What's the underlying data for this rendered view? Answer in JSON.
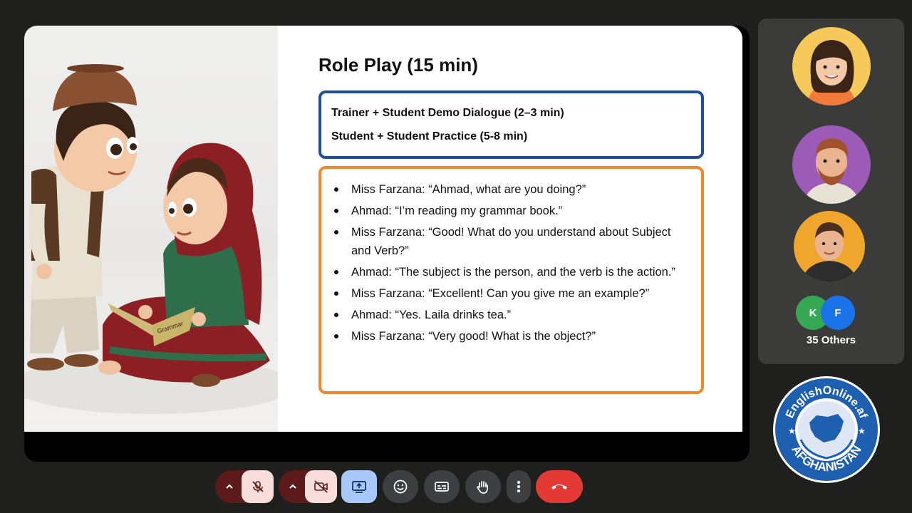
{
  "slide": {
    "title": "Role Play (15 min)",
    "modes": [
      "Trainer + Student Demo Dialogue (2–3 min)",
      "Student + Student Practice (5-8 min)"
    ],
    "dialogue": [
      "Miss Farzana: “Ahmad, what are you doing?”",
      "Ahmad: “I’m reading my grammar book.”",
      "Miss Farzana: “Good! What do you understand about Subject and Verb?”",
      "Ahmad: “The subject is the person, and the verb is the action.”",
      "Miss Farzana: “Excellent! Can you give me an example?”",
      "Ahmad: “Yes. Laila drinks tea.”",
      "Miss Farzana: “Very good! What is the object?”"
    ],
    "book_label": "Grammar"
  },
  "participants": {
    "chips": [
      {
        "initial": "K",
        "color": "#34a853"
      },
      {
        "initial": "F",
        "color": "#1a73e8"
      }
    ],
    "others_label": "35 Others"
  },
  "logo": {
    "top_text": "EnglishOnline.af",
    "bottom_text": "AFGHANISTAN"
  },
  "controls": {
    "mic_state": "muted",
    "camera_state": "off",
    "present_active": true
  },
  "colors": {
    "blue_box": "#1f4d9e",
    "orange_box": "#ef8a2c",
    "end_call": "#e53935",
    "present": "#a8c7fa"
  }
}
